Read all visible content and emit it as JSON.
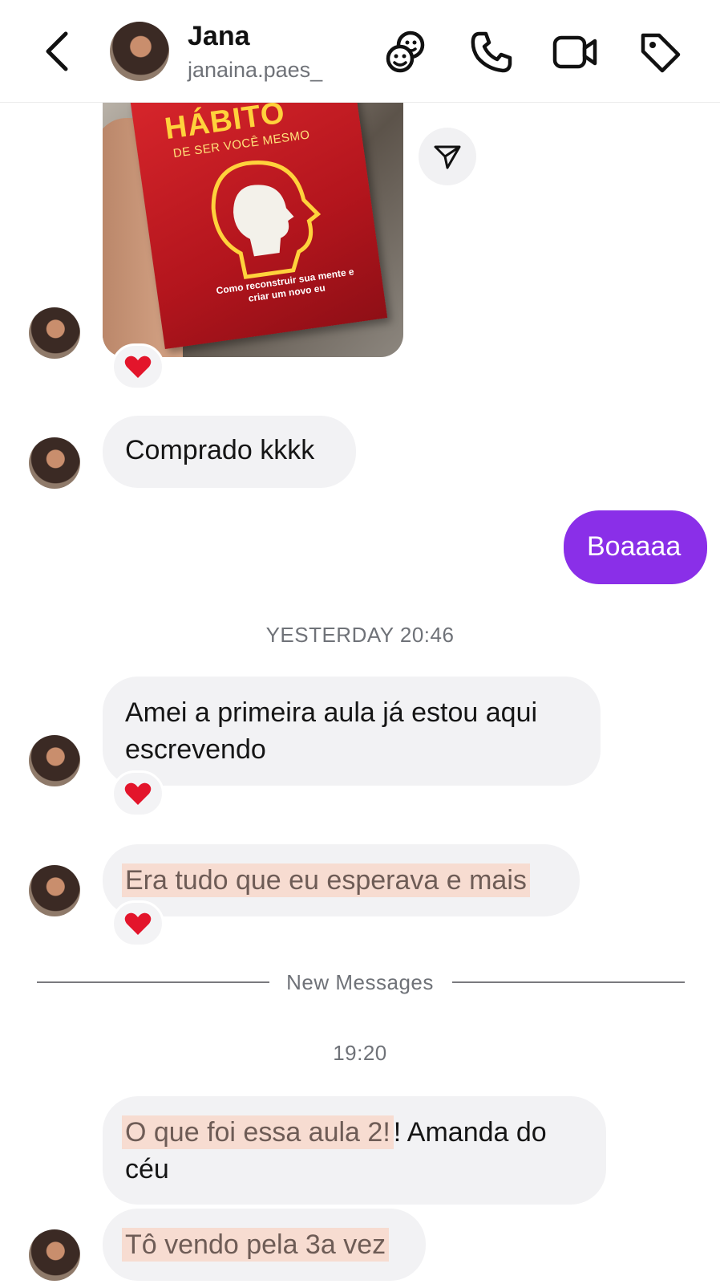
{
  "header": {
    "name": "Jana",
    "username": "janaina.paes_"
  },
  "photo": {
    "book_title": "HÁBITO",
    "book_subtitle": "DE SER VOCÊ MESMO",
    "book_tagline": "Como reconstruir sua mente e criar um novo eu"
  },
  "messages": {
    "m1": "Comprado kkkk",
    "m2": "Boaaaa",
    "ts1": "YESTERDAY 20:46",
    "m3_line1": "Amei a primeira aula já estou aqui",
    "m3_line2": "escrevendo",
    "m4": "Era tudo que eu esperava e mais",
    "new_messages": "New Messages",
    "ts2": "19:20",
    "m5_part1": "O que foi essa aula 2!",
    "m5_part2": "! Amanda do",
    "m5_line2": "céu",
    "m6": "Tô vendo pela 3a vez"
  },
  "reactions": {
    "emoji": "❤️"
  },
  "colors": {
    "accent_purple": "#8a2fe8",
    "bubble_gray": "#f2f2f4",
    "highlight": "#f7dcd1"
  }
}
